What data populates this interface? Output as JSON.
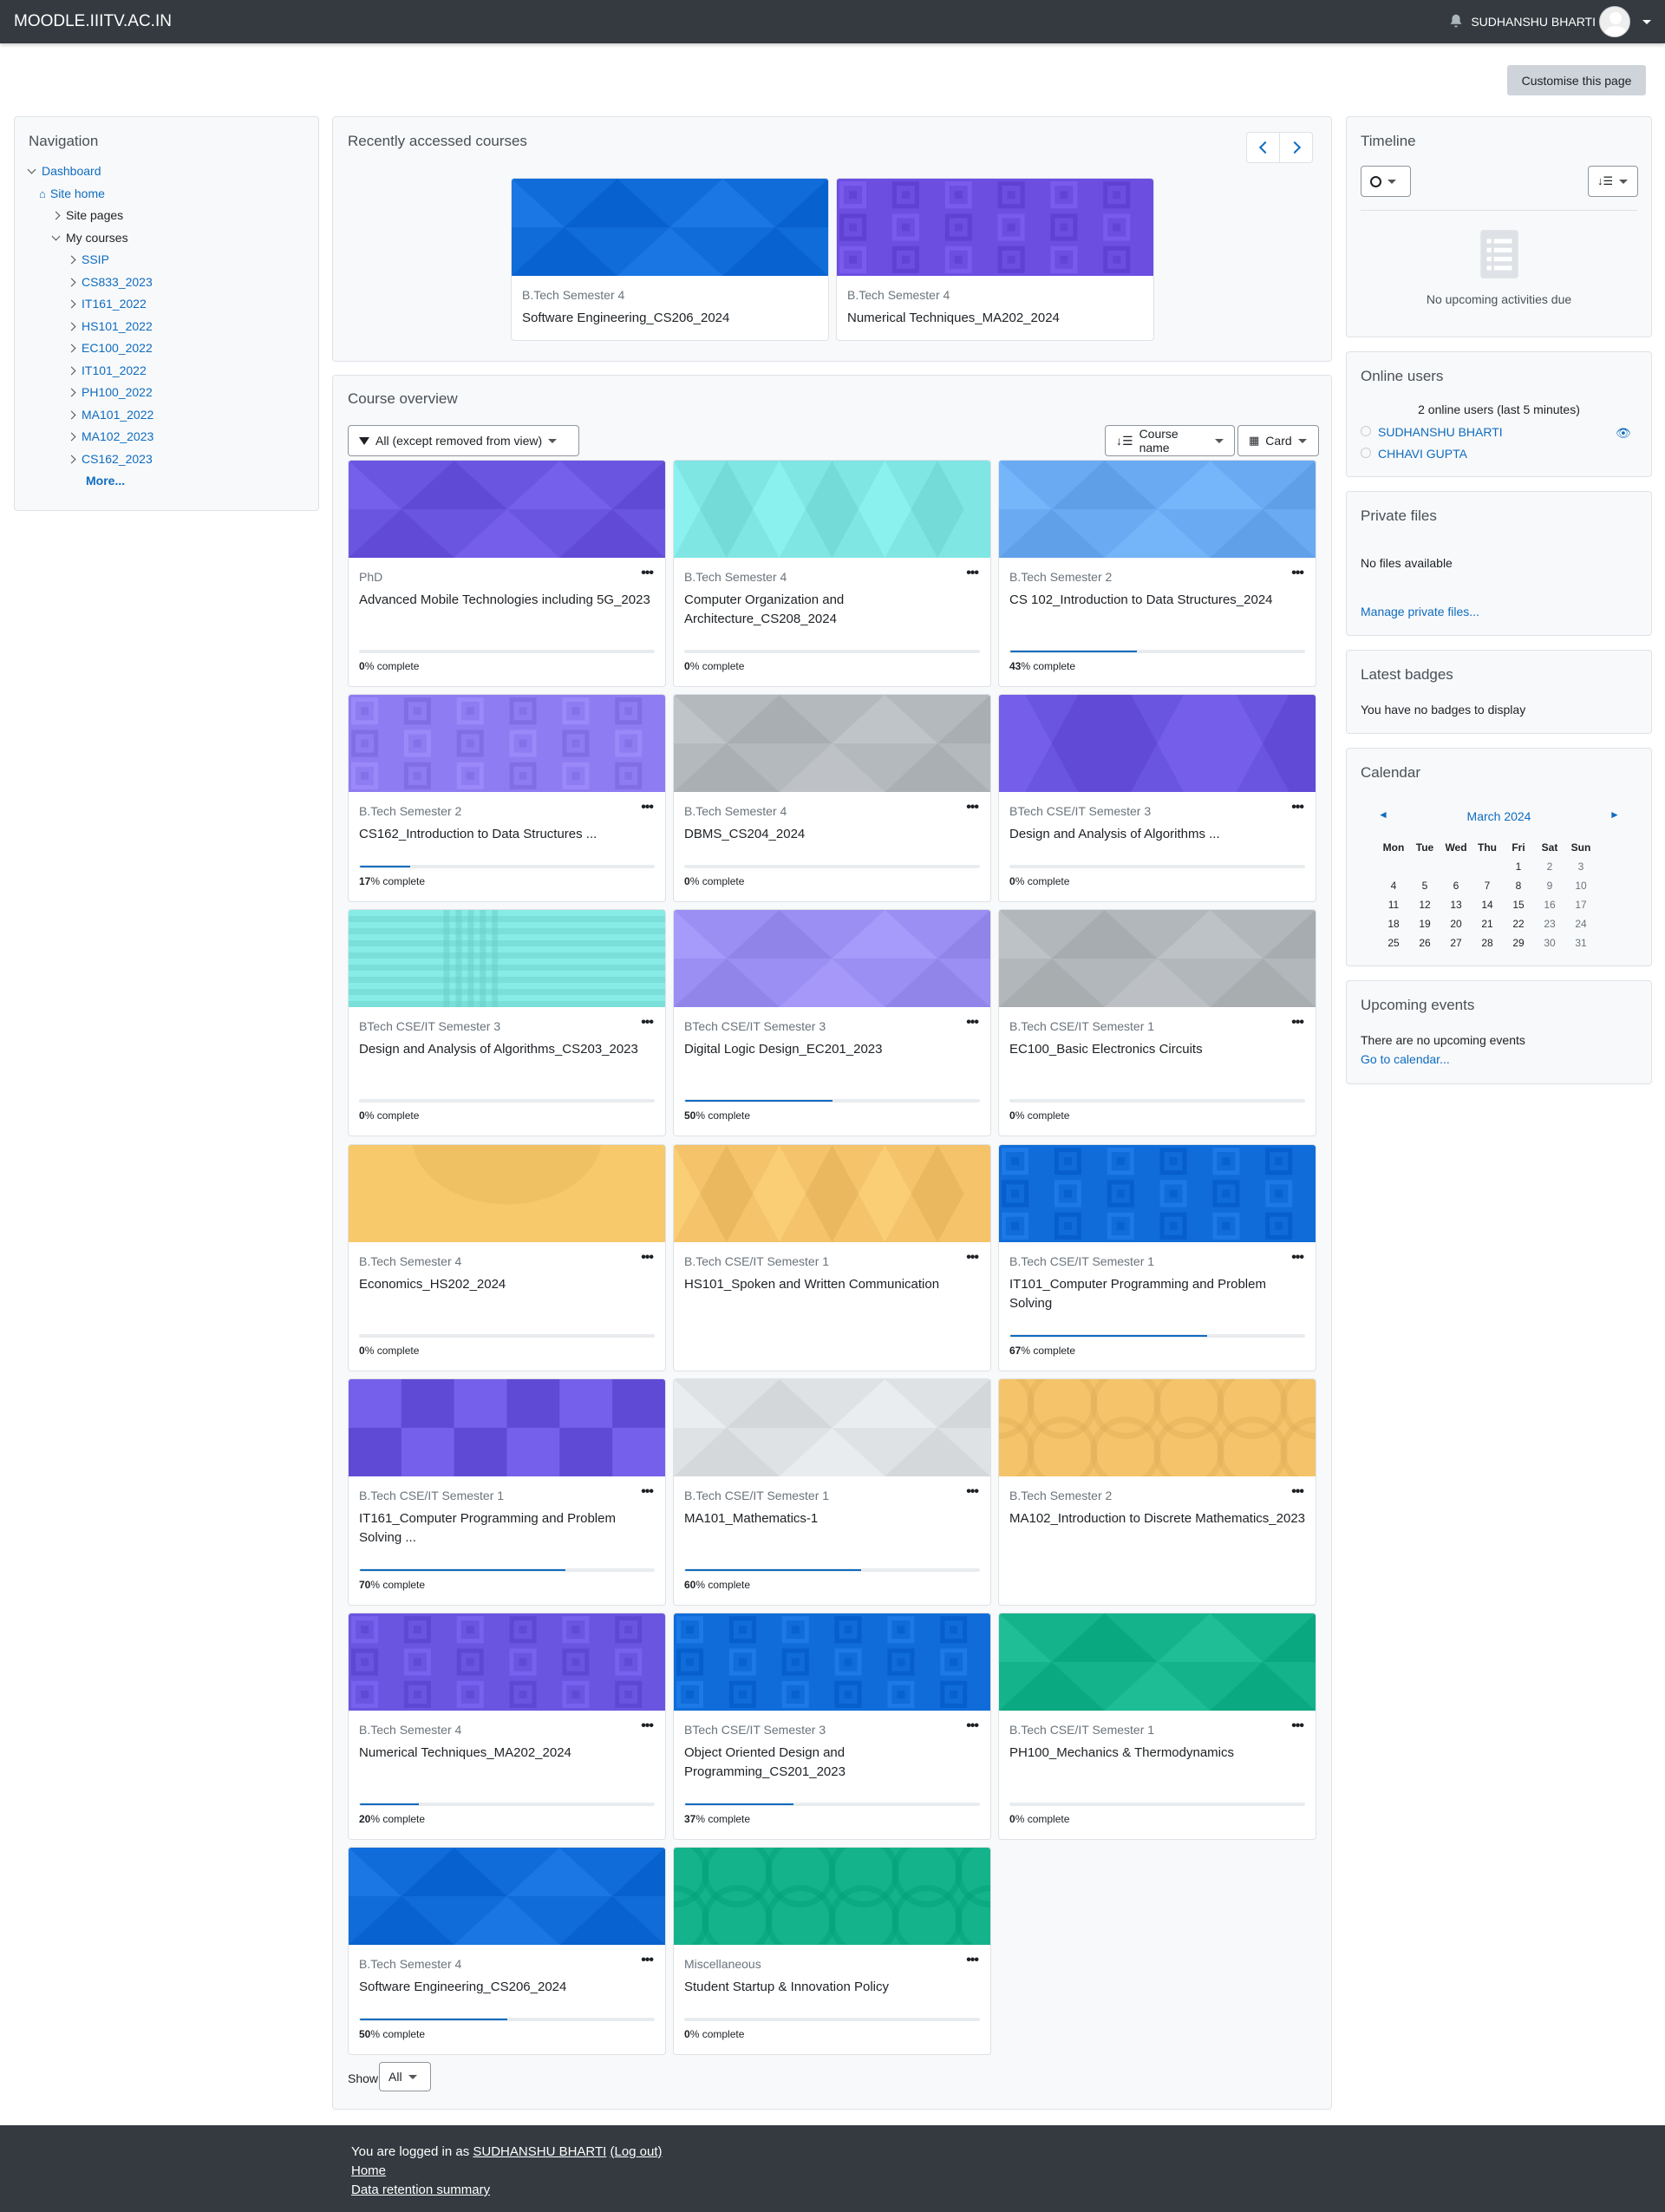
{
  "site": {
    "brand": "MOODLE.IIITV.AC.IN",
    "user_name": "SUDHANSHU BHARTI"
  },
  "page": {
    "customise_label": "Customise this page"
  },
  "navigation": {
    "title": "Navigation",
    "dashboard": "Dashboard",
    "site_home": "Site home",
    "site_pages": "Site pages",
    "my_courses": "My courses",
    "courses": [
      "SSIP",
      "CS833_2023",
      "IT161_2022",
      "HS101_2022",
      "EC100_2022",
      "IT101_2022",
      "PH100_2022",
      "MA101_2022",
      "MA102_2023",
      "CS162_2023"
    ],
    "more": "More..."
  },
  "recent": {
    "title": "Recently accessed courses",
    "courses": [
      {
        "category": "B.Tech Semester 4",
        "name": "Software Engineering_CS206_2024",
        "color": "#0f6cd9"
      },
      {
        "category": "B.Tech Semester 4",
        "name": "Numerical Techniques_MA202_2024",
        "color": "#6c4fe0"
      }
    ]
  },
  "overview": {
    "title": "Course overview",
    "filter_label": "All (except removed from view)",
    "sort_label": "Course name",
    "view_label": "Card",
    "show_label": "Show",
    "show_value": "All",
    "complete_suffix": "% complete"
  },
  "courses": [
    {
      "category": "PhD",
      "name": "Advanced Mobile Technologies including 5G_2023",
      "progress": 0,
      "color": "#6a55e0",
      "pattern": "tri"
    },
    {
      "category": "B.Tech Semester 4",
      "name": "Computer Organization and Architecture_CS208_2024",
      "progress": 0,
      "color": "#80e6e4",
      "pattern": "diamond"
    },
    {
      "category": "B.Tech Semester 2",
      "name": "CS 102_Introduction to Data Structures_2024",
      "progress": 43,
      "color": "#6aaaf2",
      "pattern": "tri"
    },
    {
      "category": "B.Tech Semester 2",
      "name": "CS162_Introduction to Data Structures ...",
      "progress": 17,
      "color": "#8e7cf2",
      "pattern": "squares"
    },
    {
      "category": "B.Tech Semester 4",
      "name": "DBMS_CS204_2024",
      "progress": 0,
      "color": "#b4b9bd",
      "pattern": "tri"
    },
    {
      "category": "BTech CSE/IT Semester 3",
      "name": "Design and Analysis of Algorithms ...",
      "progress": 0,
      "color": "#6a55e0",
      "pattern": "hex"
    },
    {
      "category": "BTech CSE/IT Semester 3",
      "name": "Design and Analysis of Algorithms_CS203_2023",
      "progress": 0,
      "color": "#7adfd8",
      "pattern": "plaid"
    },
    {
      "category": "BTech CSE/IT Semester 3",
      "name": "Digital Logic Design_EC201_2023",
      "progress": 50,
      "color": "#9b8ff4",
      "pattern": "tri"
    },
    {
      "category": "B.Tech CSE/IT Semester 1",
      "name": "EC100_Basic Electronics Circuits",
      "progress": 0,
      "color": "#b2b7bb",
      "pattern": "tri"
    },
    {
      "category": "B.Tech Semester 4",
      "name": "Economics_HS202_2024",
      "progress": 0,
      "color": "#f7c96b",
      "pattern": "circle"
    },
    {
      "category": "B.Tech CSE/IT Semester 1",
      "name": "HS101_Spoken and Written Communication",
      "progress": null,
      "color": "#f4c36a",
      "pattern": "diamond"
    },
    {
      "category": "B.Tech CSE/IT Semester 1",
      "name": "IT101_Computer Programming and Problem Solving",
      "progress": 67,
      "color": "#0f6cd9",
      "pattern": "squares"
    },
    {
      "category": "B.Tech CSE/IT Semester 1",
      "name": "IT161_Computer Programming and Problem Solving ...",
      "progress": 70,
      "color": "#6a55e0",
      "pattern": "blocks"
    },
    {
      "category": "B.Tech CSE/IT Semester 1",
      "name": "MA101_Mathematics-1",
      "progress": 60,
      "color": "#dfe2e5",
      "pattern": "tri"
    },
    {
      "category": "B.Tech Semester 2",
      "name": "MA102_Introduction to Discrete Mathematics_2023",
      "progress": null,
      "color": "#f4c36a",
      "pattern": "rings"
    },
    {
      "category": "B.Tech Semester 4",
      "name": "Numerical Techniques_MA202_2024",
      "progress": 20,
      "color": "#6a55e0",
      "pattern": "squares"
    },
    {
      "category": "BTech CSE/IT Semester 3",
      "name": "Object Oriented Design and Programming_CS201_2023",
      "progress": 37,
      "color": "#0f6cd9",
      "pattern": "squares"
    },
    {
      "category": "B.Tech CSE/IT Semester 1",
      "name": "PH100_Mechanics & Thermodynamics",
      "progress": 0,
      "color": "#14b38c",
      "pattern": "tri"
    },
    {
      "category": "B.Tech Semester 4",
      "name": "Software Engineering_CS206_2024",
      "progress": 50,
      "color": "#0f6cd9",
      "pattern": "tri"
    },
    {
      "category": "Miscellaneous",
      "name": "Student Startup & Innovation Policy",
      "progress": 0,
      "color": "#14b38c",
      "pattern": "rings"
    }
  ],
  "timeline": {
    "title": "Timeline",
    "empty": "No upcoming activities due"
  },
  "online": {
    "title": "Online users",
    "summary": "2 online users (last 5 minutes)",
    "users": [
      "SUDHANSHU BHARTI",
      "CHHAVI GUPTA"
    ]
  },
  "private_files": {
    "title": "Private files",
    "empty": "No files available",
    "manage": "Manage private files..."
  },
  "badges": {
    "title": "Latest badges",
    "empty": "You have no badges to display"
  },
  "calendar": {
    "title": "Calendar",
    "month": "March 2024",
    "days": [
      "Mon",
      "Tue",
      "Wed",
      "Thu",
      "Fri",
      "Sat",
      "Sun"
    ],
    "weeks": [
      [
        "",
        "",
        "",
        "",
        "1",
        "2",
        "3"
      ],
      [
        "4",
        "5",
        "6",
        "7",
        "8",
        "9",
        "10"
      ],
      [
        "11",
        "12",
        "13",
        "14",
        "15",
        "16",
        "17"
      ],
      [
        "18",
        "19",
        "20",
        "21",
        "22",
        "23",
        "24"
      ],
      [
        "25",
        "26",
        "27",
        "28",
        "29",
        "30",
        "31"
      ]
    ]
  },
  "upcoming": {
    "title": "Upcoming events",
    "empty": "There are no upcoming events",
    "link": "Go to calendar..."
  },
  "footer": {
    "logged_prefix": "You are logged in as ",
    "user": "SUDHANSHU BHARTI",
    "logout": "(Log out)",
    "home": "Home",
    "retention": "Data retention summary"
  }
}
